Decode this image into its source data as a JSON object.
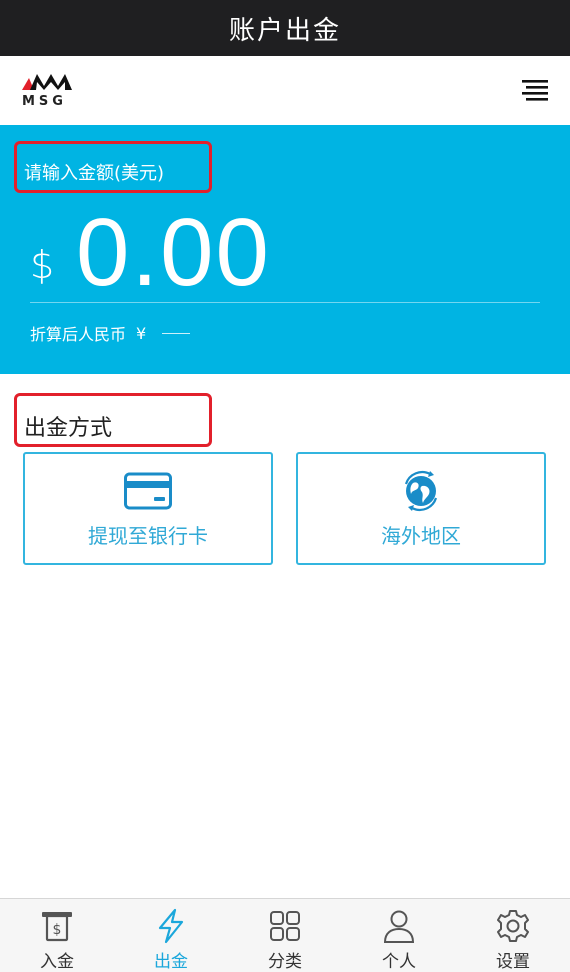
{
  "header": {
    "title": "账户出金"
  },
  "brand": {
    "logo_text": "MSG",
    "menu_icon": "menu-icon"
  },
  "amount": {
    "label": "请输入金额(美元)",
    "currency_symbol": "$",
    "value": "0.00",
    "rmb_label": "折算后人民币",
    "rmb_symbol": "¥"
  },
  "methods": {
    "title": "出金方式",
    "items": [
      {
        "label": "提现至银行卡",
        "icon": "bank-card-icon"
      },
      {
        "label": "海外地区",
        "icon": "globe-icon"
      }
    ]
  },
  "tabs": [
    {
      "label": "入金",
      "icon": "deposit-icon",
      "active": false
    },
    {
      "label": "出金",
      "icon": "lightning-icon",
      "active": true
    },
    {
      "label": "分类",
      "icon": "category-grid-icon",
      "active": false
    },
    {
      "label": "个人",
      "icon": "person-icon",
      "active": false
    },
    {
      "label": "设置",
      "icon": "gear-icon",
      "active": false
    }
  ],
  "colors": {
    "accent": "#00b4e3",
    "highlight_box": "#e2202b",
    "title_bar": "#1f1f21",
    "tab_active": "#1ba7db"
  }
}
